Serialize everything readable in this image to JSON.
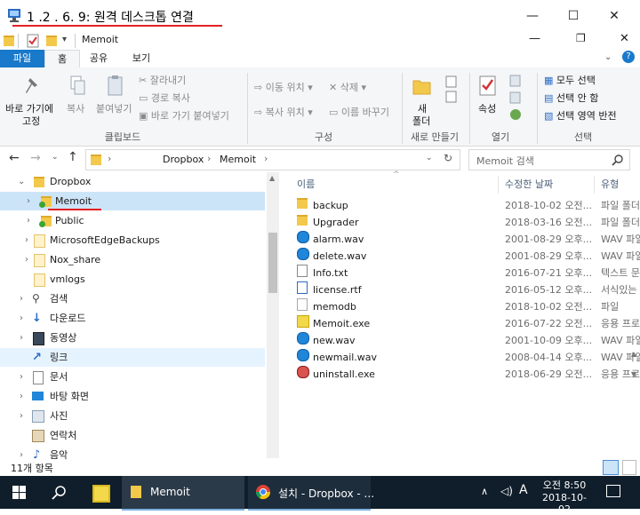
{
  "rdp": {
    "title": "1   .2    .    6. 9: 원격 데스크톱 연결"
  },
  "explorer": {
    "title": "Memoit",
    "window_controls": {
      "minimize": "—",
      "maximize": "☐",
      "close": "✕",
      "restore": "❐"
    }
  },
  "ribbon_tabs": [
    "파일",
    "홈",
    "공유",
    "보기"
  ],
  "ribbon": {
    "clipboard": {
      "pin_label_1": "바로 가기에",
      "pin_label_2": "고정",
      "copy": "복사",
      "paste": "붙여넣기",
      "cut": "잘라내기",
      "copy_path": "경로 복사",
      "paste_shortcut": "바로 가기 붙여넣기",
      "group": "클립보드"
    },
    "organize": {
      "move_to": "이동 위치",
      "copy_to": "복사 위치",
      "delete": "삭제",
      "rename": "이름 바꾸기",
      "group": "구성"
    },
    "new": {
      "new_folder_1": "새",
      "new_folder_2": "폴더",
      "group": "새로 만들기"
    },
    "open": {
      "properties": "속성",
      "group": "열기"
    },
    "select": {
      "select_all": "모두 선택",
      "select_none": "선택 안 함",
      "invert": "선택 영역 반전",
      "group": "선택"
    }
  },
  "address": {
    "crumbs": [
      "Dropbox",
      "Memoit"
    ],
    "search_placeholder": "Memoit 검색"
  },
  "nav_items": [
    {
      "label": "Dropbox",
      "type": "dropbox-folder"
    },
    {
      "label": "Memoit",
      "type": "sync-folder"
    },
    {
      "label": "Public",
      "type": "sync-folder"
    },
    {
      "label": "MicrosoftEdgeBackups",
      "type": "folder"
    },
    {
      "label": "Nox_share",
      "type": "folder"
    },
    {
      "label": "vmlogs",
      "type": "folder"
    },
    {
      "label": "검색",
      "type": "search"
    },
    {
      "label": "다운로드",
      "type": "download"
    },
    {
      "label": "동영상",
      "type": "video"
    },
    {
      "label": "링크",
      "type": "link"
    },
    {
      "label": "문서",
      "type": "document"
    },
    {
      "label": "바탕 화면",
      "type": "desktop"
    },
    {
      "label": "사진",
      "type": "pictures"
    },
    {
      "label": "연락처",
      "type": "contacts"
    },
    {
      "label": "음악",
      "type": "music"
    }
  ],
  "columns": {
    "name": "이름",
    "date": "수정한 날짜",
    "type": "유형"
  },
  "files": [
    {
      "name": "backup",
      "date": "2018-10-02 오전...",
      "type": "파일 폴더",
      "icon": "folder"
    },
    {
      "name": "Upgrader",
      "date": "2018-03-16 오전...",
      "type": "파일 폴더",
      "icon": "folder"
    },
    {
      "name": "alarm.wav",
      "date": "2001-08-29 오후...",
      "type": "WAV 파일",
      "icon": "audio"
    },
    {
      "name": "delete.wav",
      "date": "2001-08-29 오후...",
      "type": "WAV 파일",
      "icon": "audio"
    },
    {
      "name": "Info.txt",
      "date": "2016-07-21 오후...",
      "type": "텍스트 문서",
      "icon": "text"
    },
    {
      "name": "license.rtf",
      "date": "2016-05-12 오후...",
      "type": "서식있는 텍스트",
      "icon": "rtf"
    },
    {
      "name": "memodb",
      "date": "2018-10-02 오전...",
      "type": "파일",
      "icon": "file"
    },
    {
      "name": "Memoit.exe",
      "date": "2016-07-22 오전...",
      "type": "응용 프로그램",
      "icon": "exe"
    },
    {
      "name": "new.wav",
      "date": "2001-10-09 오후...",
      "type": "WAV 파일",
      "icon": "audio"
    },
    {
      "name": "newmail.wav",
      "date": "2008-04-14 오후...",
      "type": "WAV 파일",
      "icon": "audio"
    },
    {
      "name": "uninstall.exe",
      "date": "2018-06-29 오전...",
      "type": "응용 프로그램",
      "icon": "uninstall"
    }
  ],
  "status": {
    "count": "11개 항목"
  },
  "taskbar": {
    "explorer_label": "Memoit",
    "chrome_label": "설치 - Dropbox - ...",
    "ime": "A",
    "time": "오전 8:50",
    "date": "2018-10-02"
  }
}
